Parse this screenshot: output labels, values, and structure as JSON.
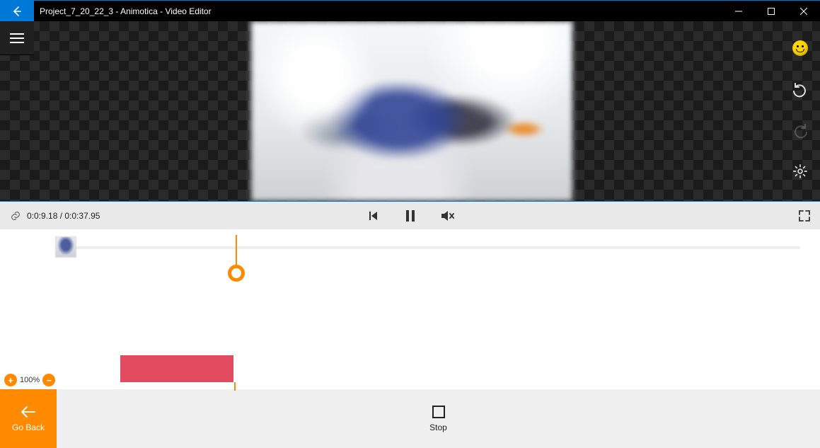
{
  "window": {
    "title": "Project_7_20_22_3 - Animotica - Video Editor"
  },
  "playbar": {
    "time": "0:0:9.18 / 0:0:37.95"
  },
  "zoom": {
    "value": "100%"
  },
  "bottom": {
    "go_back": "Go Back",
    "stop": "Stop"
  },
  "side_tools": {
    "emoji": "emoji-icon",
    "undo": "undo-icon",
    "redo": "redo-icon",
    "settings": "settings-icon"
  }
}
